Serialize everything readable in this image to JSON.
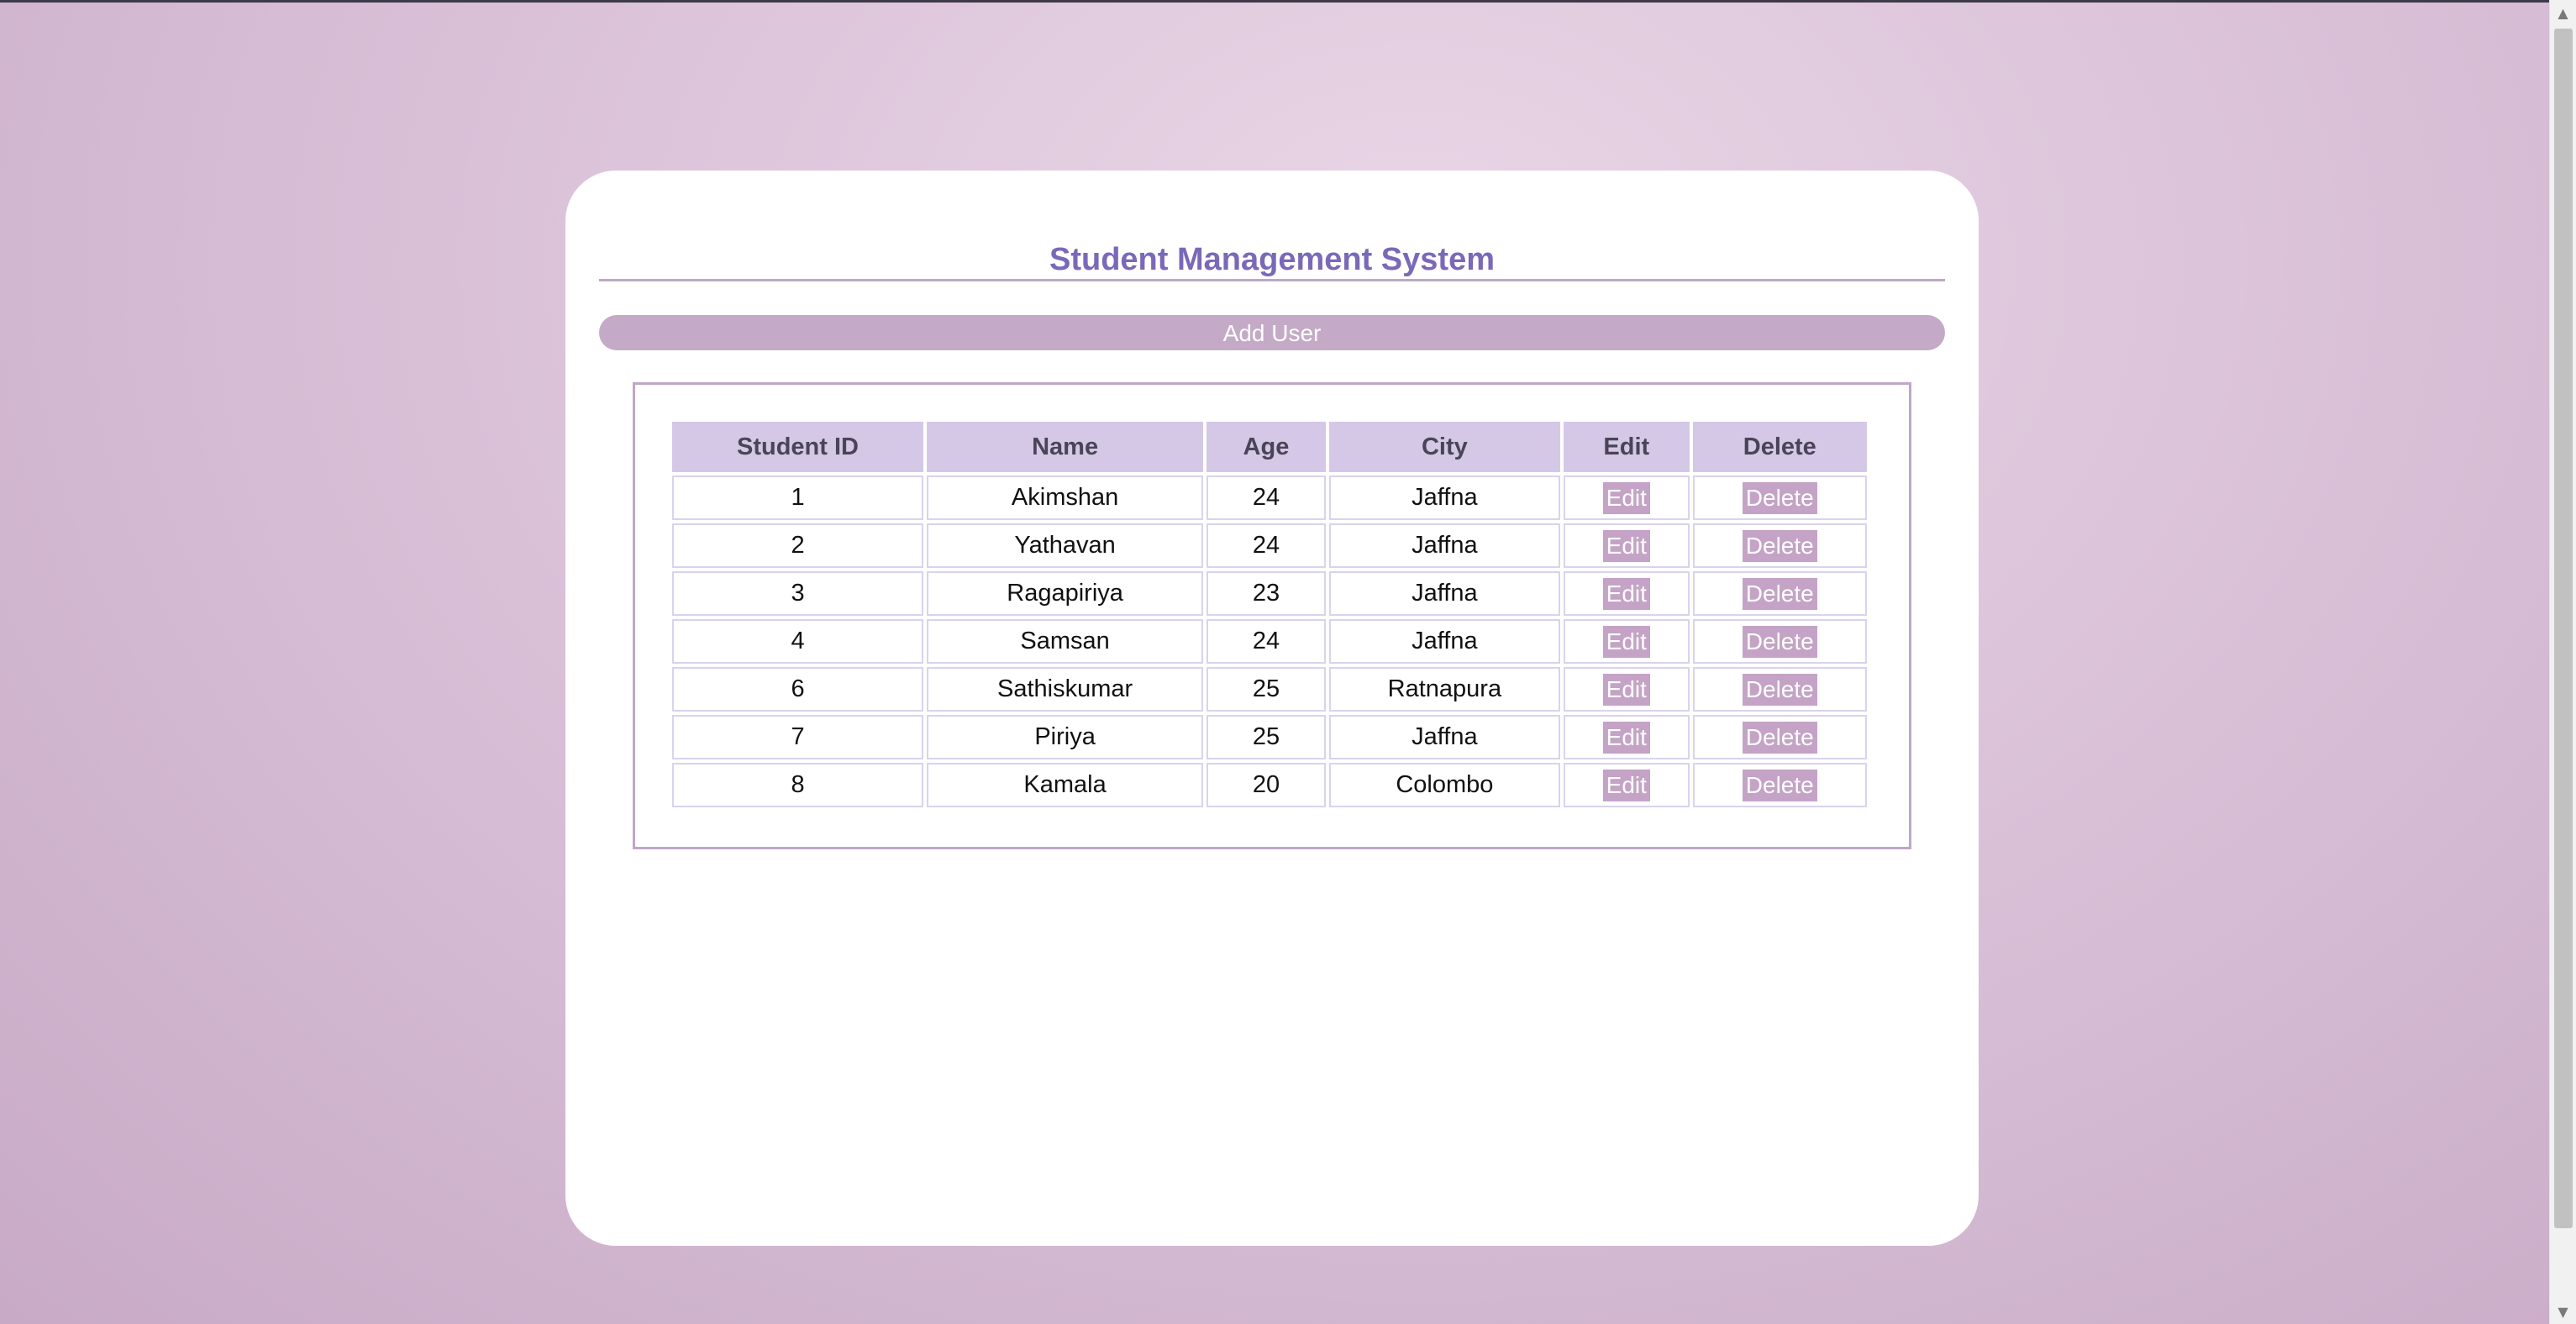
{
  "app": {
    "title": "Student Management System",
    "add_user_label": "Add User"
  },
  "table": {
    "headers": {
      "id": "Student ID",
      "name": "Name",
      "age": "Age",
      "city": "City",
      "edit": "Edit",
      "delete": "Delete"
    },
    "edit_label": "Edit",
    "delete_label": "Delete",
    "rows": [
      {
        "id": "1",
        "name": "Akimshan",
        "age": "24",
        "city": "Jaffna"
      },
      {
        "id": "2",
        "name": "Yathavan",
        "age": "24",
        "city": "Jaffna"
      },
      {
        "id": "3",
        "name": "Ragapiriya",
        "age": "23",
        "city": "Jaffna"
      },
      {
        "id": "4",
        "name": "Samsan",
        "age": "24",
        "city": "Jaffna"
      },
      {
        "id": "6",
        "name": "Sathiskumar",
        "age": "25",
        "city": "Ratnapura"
      },
      {
        "id": "7",
        "name": "Piriya",
        "age": "25",
        "city": "Jaffna"
      },
      {
        "id": "8",
        "name": "Kamala",
        "age": "20",
        "city": "Colombo"
      }
    ]
  },
  "colors": {
    "accent": "#7a68b8",
    "button": "#c4a3c6",
    "header_bg": "#d4c8e6"
  }
}
